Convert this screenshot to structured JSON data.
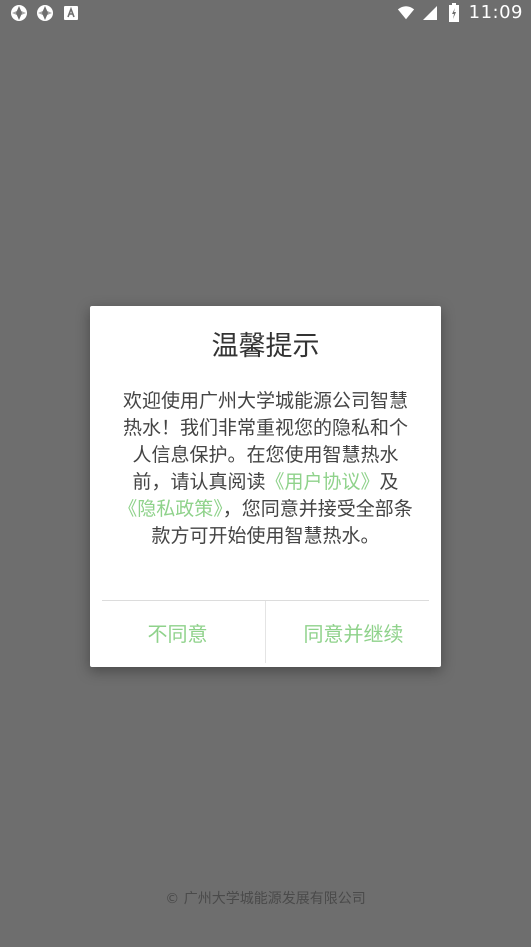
{
  "status_bar": {
    "time": "11:09",
    "left_icons": [
      "aperture-icon",
      "aperture-icon",
      "a-letter-icon"
    ],
    "right_icons": [
      "wifi-icon",
      "signal-icon",
      "battery-icon"
    ]
  },
  "dialog": {
    "title": "温馨提示",
    "body": {
      "text_before": "欢迎使用广州大学城能源公司智慧热水！我们非常重视您的隐私和个人信息保护。在您使用智慧热水前，请认真阅读",
      "user_agreement_link": "《用户协议》",
      "text_middle": "及",
      "privacy_policy_link": "《隐私政策》",
      "text_after": "，您同意并接受全部条款方可开始使用智慧热水。"
    },
    "buttons": {
      "disagree": "不同意",
      "agree": "同意并继续"
    }
  },
  "footer": {
    "copyright": "© 广州大学城能源发展有限公司"
  },
  "colors": {
    "overlay_background": "#6e6e6e",
    "link_green": "#8fd28b",
    "dialog_background": "#ffffff"
  }
}
